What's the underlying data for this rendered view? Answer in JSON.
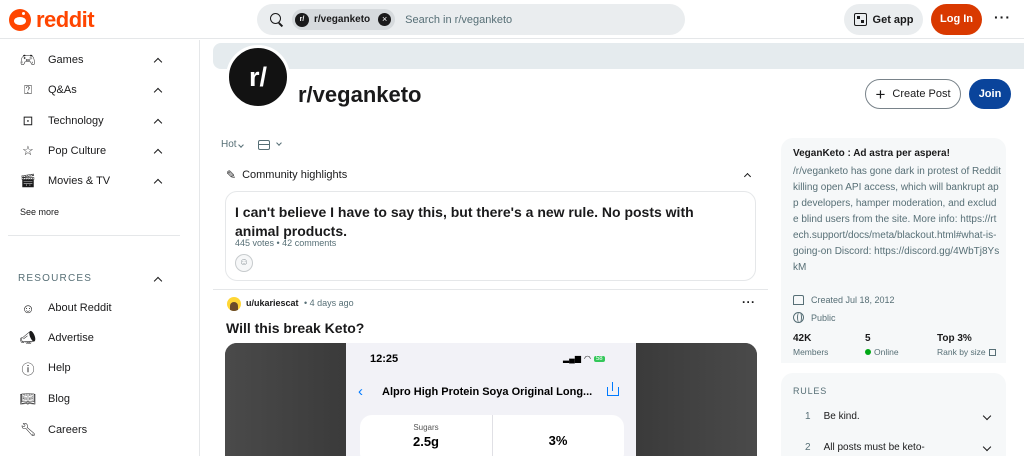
{
  "header": {
    "logo_text": "reddit",
    "search_chip": "r/veganketo",
    "search_placeholder": "Search in r/veganketo",
    "get_app_label": "Get app",
    "login_label": "Log In"
  },
  "sidebar": {
    "items": [
      {
        "label": "Games",
        "icon": "gamepad-icon"
      },
      {
        "label": "Q&As",
        "icon": "qa-icon"
      },
      {
        "label": "Technology",
        "icon": "chip-icon"
      },
      {
        "label": "Pop Culture",
        "icon": "star-icon"
      },
      {
        "label": "Movies & TV",
        "icon": "clapperboard-icon"
      }
    ],
    "see_more": "See more",
    "resources_header": "RESOURCES",
    "resources": [
      {
        "label": "About Reddit",
        "icon": "reddit-alien-icon"
      },
      {
        "label": "Advertise",
        "icon": "megaphone-icon"
      },
      {
        "label": "Help",
        "icon": "help-icon"
      },
      {
        "label": "Blog",
        "icon": "book-icon"
      },
      {
        "label": "Careers",
        "icon": "wrench-icon"
      }
    ]
  },
  "subreddit": {
    "avatar_text": "r/",
    "name": "r/veganketo",
    "create_post_label": "Create Post",
    "join_label": "Join"
  },
  "feed": {
    "sort_label": "Hot",
    "highlights_label": "Community highlights",
    "highlight_card": {
      "title": "I can't believe I have to say this, but there's a new rule. No posts with animal products.",
      "meta": "445 votes • 42 comments"
    },
    "post": {
      "user": "u/ukariescat",
      "time": "• 4 days ago",
      "title": "Will this break Keto?",
      "phone": {
        "time": "12:25",
        "battery": "58",
        "product_title": "Alpro High Protein Soya Original Long...",
        "nutrient_label": "Sugars",
        "nutrient_value": "2.5g",
        "nutrient_pct": "3%"
      }
    }
  },
  "about": {
    "title": "VeganKeto : Ad astra per aspera!",
    "description": "/r/veganketo has gone dark in protest of Reddit killing open API access, which will bankrupt app developers, hamper moderation, and exclude blind users from the site. More info: https://rtech.support/docs/meta/blackout.html#what-is-going-on Discord: https://discord.gg/4WbTj8YskM",
    "created": "Created Jul 18, 2012",
    "visibility": "Public",
    "stats": [
      {
        "value": "42K",
        "label": "Members"
      },
      {
        "value": "5",
        "label": "Online"
      },
      {
        "value": "Top 3%",
        "label": "Rank by size"
      }
    ]
  },
  "rules": {
    "header": "RULES",
    "items": [
      {
        "num": "1",
        "text": "Be kind."
      },
      {
        "num": "2",
        "text": "All posts must be keto-"
      }
    ]
  },
  "colors": {
    "brand": "#ff4500",
    "login": "#d93900",
    "join": "#0a449b",
    "online": "#01a816"
  }
}
